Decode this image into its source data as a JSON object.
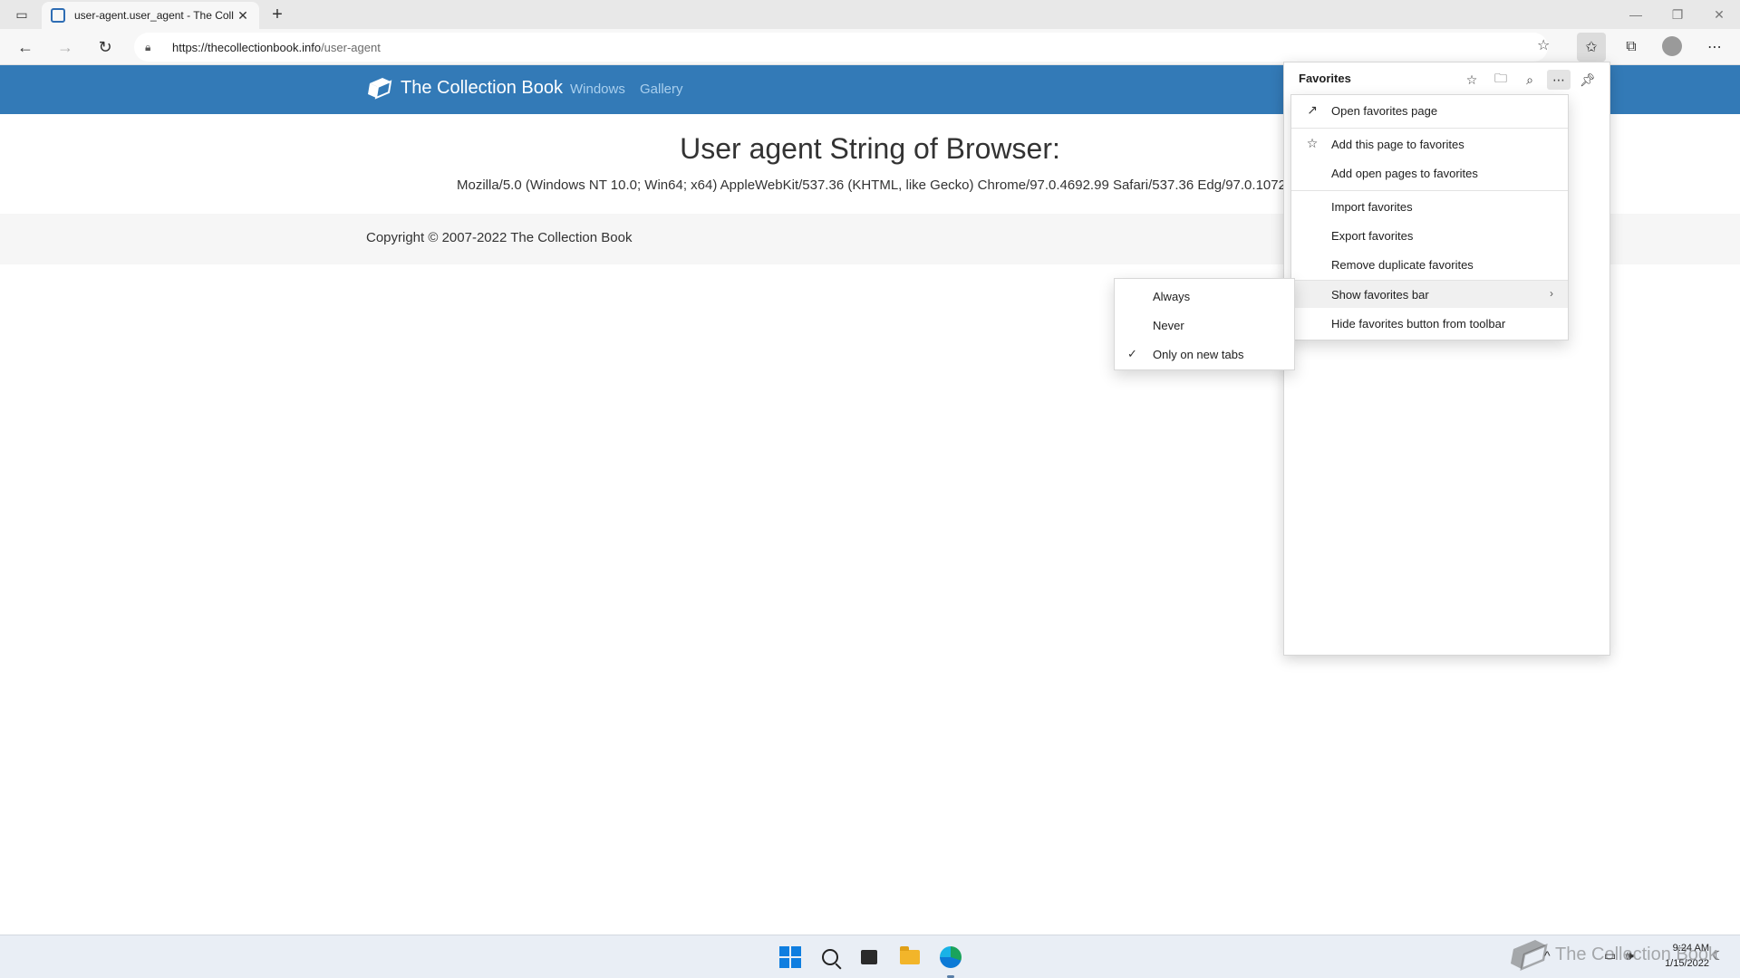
{
  "browser": {
    "tab_title": "user-agent.user_agent - The Coll",
    "url_host": "https://thecollectionbook.info",
    "url_path": "/user-agent"
  },
  "site": {
    "brand": "The Collection Book",
    "nav": [
      "Windows",
      "Gallery"
    ],
    "heading": "User agent String of Browser:",
    "ua_string": "Mozilla/5.0 (Windows NT 10.0; Win64; x64) AppleWebKit/537.36 (KHTML, like Gecko) Chrome/97.0.4692.99 Safari/537.36 Edg/97.0.1072.69",
    "copyright": "Copyright © 2007-2022 The Collection Book"
  },
  "favorites": {
    "title": "Favorites",
    "header_icons": [
      "add-favorite-icon",
      "add-folder-icon",
      "search-icon",
      "more-icon",
      "pin-icon"
    ],
    "menu": {
      "open_page": "Open favorites page",
      "add_this": "Add this page to favorites",
      "add_open": "Add open pages to favorites",
      "import": "Import favorites",
      "export": "Export favorites",
      "remove_dup": "Remove duplicate favorites",
      "show_bar": "Show favorites bar",
      "hide_button": "Hide favorites button from toolbar"
    },
    "submenu": {
      "always": "Always",
      "never": "Never",
      "only_new_tabs": "Only on new tabs",
      "selected": "Only on new tabs"
    }
  },
  "taskbar": {
    "time": "9:24 AM",
    "date": "1/15/2022",
    "watermark": "The Collection Book"
  },
  "colors": {
    "site_header": "#337ab7",
    "nav_link": "#a9cfee",
    "windows_blue": "#0f7ee0"
  }
}
